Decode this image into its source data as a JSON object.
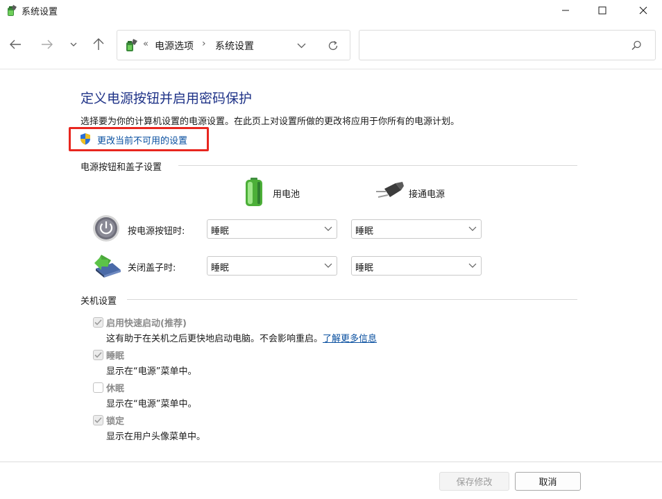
{
  "window": {
    "title": "系统设置"
  },
  "address": {
    "chevron": "«",
    "crumbs": [
      "电源选项",
      "系统设置"
    ],
    "separator": "›"
  },
  "search": {
    "placeholder": ""
  },
  "content": {
    "title": "定义电源按钮并启用密码保护",
    "description": "选择要为你的计算机设置的电源设置。在此页上对设置所做的更改将应用于你所有的电源计划。",
    "change_link": "更改当前不可用的设置"
  },
  "power_section": {
    "heading": "电源按钮和盖子设置",
    "col_battery": "用电池",
    "col_plugged": "接通电源",
    "rows": [
      {
        "label": "按电源按钮时:",
        "battery": "睡眠",
        "plugged": "睡眠"
      },
      {
        "label": "关闭盖子时:",
        "battery": "睡眠",
        "plugged": "睡眠"
      }
    ]
  },
  "shutdown_section": {
    "heading": "关机设置",
    "options": [
      {
        "label": "启用快速启动(推荐)",
        "checked": true,
        "desc": "这有助于在关机之后更快地启动电脑。不会影响重启。",
        "link": "了解更多信息"
      },
      {
        "label": "睡眠",
        "checked": true,
        "desc": "显示在“电源”菜单中。"
      },
      {
        "label": "休眠",
        "checked": false,
        "desc": "显示在“电源”菜单中。"
      },
      {
        "label": "锁定",
        "checked": true,
        "desc": "显示在用户头像菜单中。"
      }
    ]
  },
  "buttons": {
    "save": "保存修改",
    "cancel": "取消"
  },
  "colors": {
    "title_blue": "#1e3287",
    "link_blue": "#0a50a0",
    "highlight_red": "#e8261f"
  }
}
